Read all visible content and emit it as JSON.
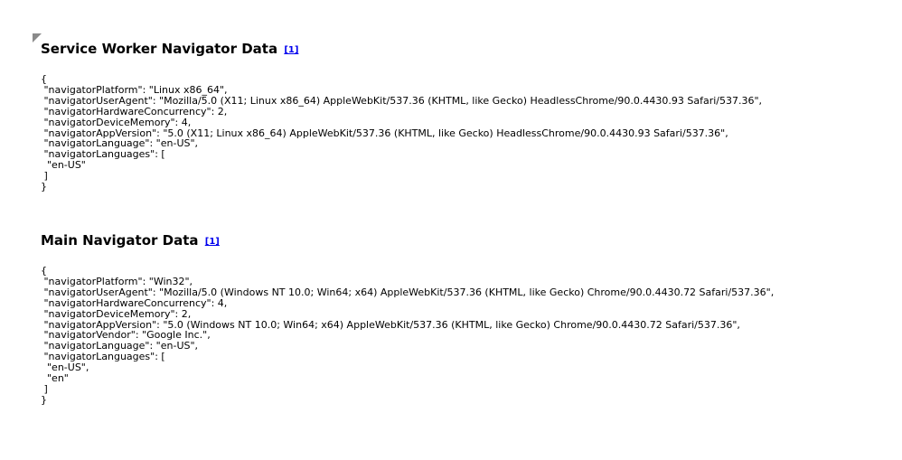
{
  "sections": [
    {
      "title": "Service Worker Navigator Data",
      "ref_link": "[1]",
      "json_text": "{\n \"navigatorPlatform\": \"Linux x86_64\",\n \"navigatorUserAgent\": \"Mozilla/5.0 (X11; Linux x86_64) AppleWebKit/537.36 (KHTML, like Gecko) HeadlessChrome/90.0.4430.93 Safari/537.36\",\n \"navigatorHardwareConcurrency\": 2,\n \"navigatorDeviceMemory\": 4,\n \"navigatorAppVersion\": \"5.0 (X11; Linux x86_64) AppleWebKit/537.36 (KHTML, like Gecko) HeadlessChrome/90.0.4430.93 Safari/537.36\",\n \"navigatorLanguage\": \"en-US\",\n \"navigatorLanguages\": [\n  \"en-US\"\n ]\n}"
    },
    {
      "title": "Main Navigator Data",
      "ref_link": "[1]",
      "json_text": "{\n \"navigatorPlatform\": \"Win32\",\n \"navigatorUserAgent\": \"Mozilla/5.0 (Windows NT 10.0; Win64; x64) AppleWebKit/537.36 (KHTML, like Gecko) Chrome/90.0.4430.72 Safari/537.36\",\n \"navigatorHardwareConcurrency\": 4,\n \"navigatorDeviceMemory\": 2,\n \"navigatorAppVersion\": \"5.0 (Windows NT 10.0; Win64; x64) AppleWebKit/537.36 (KHTML, like Gecko) Chrome/90.0.4430.72 Safari/537.36\",\n \"navigatorVendor\": \"Google Inc.\",\n \"navigatorLanguage\": \"en-US\",\n \"navigatorLanguages\": [\n  \"en-US\",\n  \"en\"\n ]\n}"
    }
  ]
}
